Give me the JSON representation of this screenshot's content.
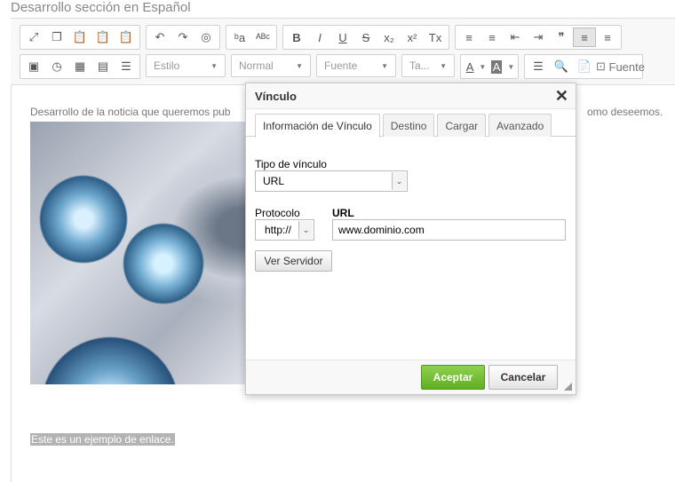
{
  "page_title": "Desarrollo sección en Español",
  "toolbar": {
    "row1_groups": [
      [
        "maximize-icon",
        "copy-icon",
        "paste-icon",
        "paste-text-icon",
        "paste-word-icon"
      ],
      [
        "undo-icon",
        "redo-icon",
        "browser-icon"
      ],
      [
        "find-replace-icon",
        "spellcheck-icon"
      ],
      [
        "bold-icon",
        "italic-icon",
        "underline-icon",
        "strike-icon",
        "subscript-icon",
        "superscript-icon",
        "remove-format-icon"
      ],
      [
        "numbered-list-icon",
        "bullet-list-icon",
        "outdent-icon",
        "indent-icon",
        "blockquote-icon",
        "align-left-icon",
        "align-center-icon"
      ]
    ],
    "row1_glyphs": [
      [
        "⤢",
        "❐",
        "📋",
        "📋",
        "📋"
      ],
      [
        "↶",
        "↷",
        "◎"
      ],
      [
        "ᵇa",
        "ᴬᴮᶜ"
      ],
      [
        "B",
        "I",
        "U",
        "S",
        "x₂",
        "x²",
        "Tx"
      ],
      [
        "≡",
        "≡",
        "⇤",
        "⇥",
        "❞",
        "≡",
        "≡"
      ]
    ],
    "row2_left_glyphs": [
      "▣",
      "◷",
      "▦",
      "▤",
      "☰"
    ],
    "style_label": "Estilo",
    "format_label": "Normal",
    "font_label": "Fuente",
    "size_label": "Ta...",
    "text_color_glyph": "A",
    "bg_color_glyph": "A",
    "row2_right_glyphs": [
      "☰",
      "🔍",
      "📄"
    ],
    "source_label": "Fuente"
  },
  "editor": {
    "paragraph_start": "Desarrollo de la noticia que queremos pub",
    "paragraph_end": "omo deseemos.",
    "link_text": "Este es un ejemplo de enlace."
  },
  "dialog": {
    "title": "Vínculo",
    "close_glyph": "✕",
    "tabs": [
      "Información de Vínculo",
      "Destino",
      "Cargar",
      "Avanzado"
    ],
    "link_type_label": "Tipo de vínculo",
    "link_type_value": "URL",
    "protocol_label": "Protocolo",
    "protocol_value": "http://",
    "url_label": "URL",
    "url_value": "www.dominio.com",
    "browse_server_label": "Ver Servidor",
    "ok_label": "Aceptar",
    "cancel_label": "Cancelar"
  }
}
